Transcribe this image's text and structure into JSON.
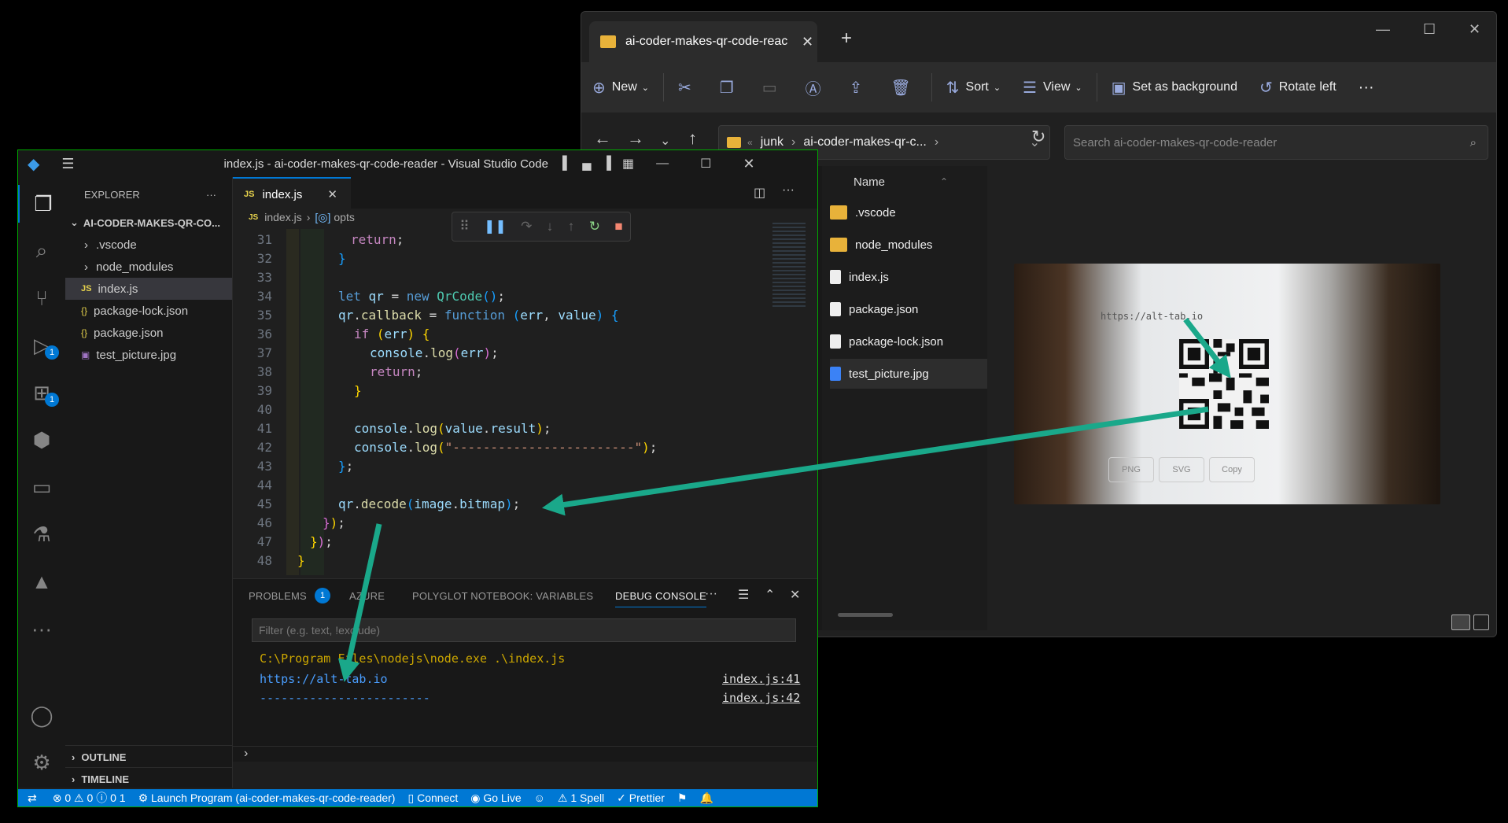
{
  "explorer": {
    "tab_title": "ai-coder-makes-qr-code-reac",
    "commands": {
      "new": "New",
      "sort": "Sort",
      "view": "View",
      "set_bg": "Set as background",
      "rotate": "Rotate left"
    },
    "address": {
      "root": "junk",
      "folder": "ai-coder-makes-qr-c..."
    },
    "search_placeholder": "Search ai-coder-makes-qr-code-reader",
    "column_name": "Name",
    "files": [
      {
        "name": ".vscode",
        "type": "folder"
      },
      {
        "name": "node_modules",
        "type": "folder"
      },
      {
        "name": "index.js",
        "type": "file"
      },
      {
        "name": "package.json",
        "type": "file"
      },
      {
        "name": "package-lock.json",
        "type": "file"
      },
      {
        "name": "test_picture.jpg",
        "type": "image",
        "selected": true
      }
    ],
    "preview_url_text": "https://alt-tab.io",
    "preview_buttons": [
      "PNG",
      "SVG",
      "Copy"
    ]
  },
  "vscode": {
    "window_title": "index.js - ai-coder-makes-qr-code-reader - Visual Studio Code",
    "explorer_label": "EXPLORER",
    "project": "AI-CODER-MAKES-QR-CO...",
    "tree": [
      ".vscode",
      "node_modules",
      "index.js",
      "package-lock.json",
      "package.json",
      "test_picture.jpg"
    ],
    "outline": "OUTLINE",
    "timeline": "TIMELINE",
    "tab": "index.js",
    "breadcrumb": [
      "index.js",
      "opts"
    ],
    "activity_badges": {
      "debug": "1",
      "extensions": "1"
    },
    "panel_tabs": [
      "PROBLEMS",
      "AZURE",
      "POLYGLOT NOTEBOOK: VARIABLES",
      "DEBUG CONSOLE"
    ],
    "problems_count": "1",
    "filter_placeholder": "Filter (e.g. text, !exclude)",
    "console": {
      "cmd": "C:\\Program Files\\nodejs\\node.exe .\\index.js",
      "out1": "https://alt-tab.io",
      "out2": "------------------------",
      "ref1": "index.js:41",
      "ref2": "index.js:42"
    },
    "status": {
      "errors": "0",
      "warnings": "0",
      "infos": "0",
      "ports": "1",
      "launch": "Launch Program (ai-coder-makes-qr-code-reader)",
      "connect": "Connect",
      "golive": "Go Live",
      "spell": "1 Spell",
      "prettier": "Prettier"
    }
  },
  "colors": {
    "vscode_accent": "#0078d4",
    "arrow": "#1aa88a"
  }
}
